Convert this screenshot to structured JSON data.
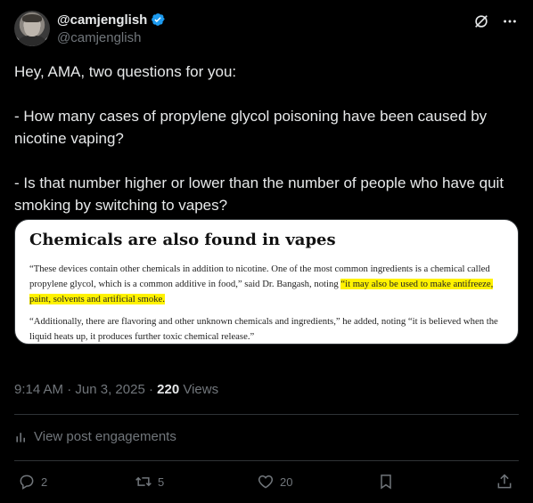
{
  "author": {
    "display_name": "@camjenglish",
    "handle": "@camjenglish"
  },
  "icons": {
    "verified": "verified-badge-icon",
    "grok": "grok-icon",
    "more": "more-icon"
  },
  "tweet": {
    "text": "Hey, AMA, two questions for you:\n\n- How many cases of propylene glycol poisoning have been caused by nicotine vaping?\n\n- Is that number higher or lower than the number of people who have quit smoking by switching to vapes?"
  },
  "media": {
    "title": "Chemicals are also found in vapes",
    "p1_a": "“These devices contain other chemicals in addition to nicotine. One of the most common ingredients is a chemical called propylene glycol, which is a common additive in food,” said Dr. Bangash, noting ",
    "p1_highlight": "“it may also be used to make antifreeze, paint, solvents and artificial smoke.",
    "p2": "“Additionally, there are flavoring and other unknown chemicals and ingredients,” he added, noting “it is believed when the liquid heats up, it produces further toxic chemical release.”"
  },
  "meta": {
    "time": "9:14 AM",
    "sep1": "·",
    "date": "Jun 3, 2025",
    "sep2": "·",
    "views_count": "220",
    "views_label": "Views"
  },
  "engagements": {
    "label": "View post engagements"
  },
  "actions": {
    "replies": "2",
    "reposts": "5",
    "likes": "20"
  },
  "colors": {
    "background": "#000000",
    "text": "#e7e9ea",
    "muted": "#71767b",
    "verified": "#1d9bf0",
    "highlight": "#fff200",
    "divider": "#2f3336"
  }
}
